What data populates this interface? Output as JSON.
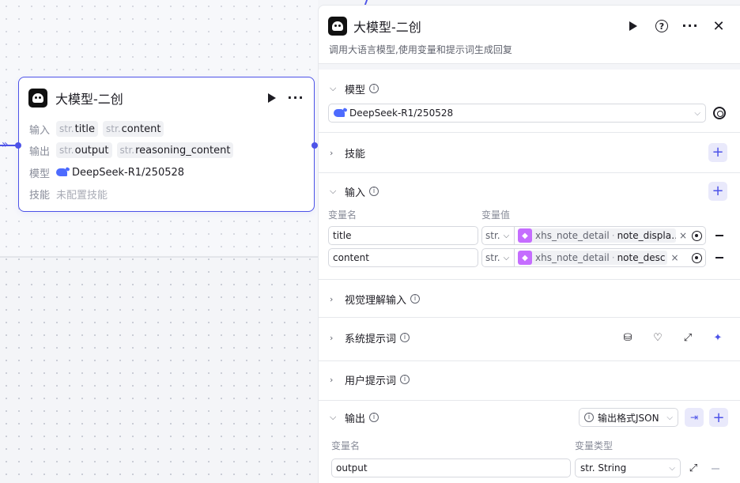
{
  "node": {
    "title": "大模型-二创",
    "input_label": "输入",
    "output_label": "输出",
    "model_label": "模型",
    "skill_label": "技能",
    "inputs": [
      {
        "type": "str.",
        "name": "title"
      },
      {
        "type": "str.",
        "name": "content"
      }
    ],
    "outputs": [
      {
        "type": "str.",
        "name": "output"
      },
      {
        "type": "str.",
        "name": "reasoning_content"
      }
    ],
    "model": "DeepSeek-R1/250528",
    "skill_value": "未配置技能"
  },
  "panel": {
    "title": "大模型-二创",
    "description": "调用大语言模型,使用变量和提示词生成回复",
    "sections": {
      "model": {
        "title": "模型",
        "selected": "DeepSeek-R1/250528"
      },
      "skills": {
        "title": "技能"
      },
      "input": {
        "title": "输入",
        "col_name": "变量名",
        "col_value": "变量值",
        "rows": [
          {
            "name": "title",
            "type": "str.",
            "ref_node": "xhs_note_detail",
            "ref_field": "note_displa…"
          },
          {
            "name": "content",
            "type": "str.",
            "ref_node": "xhs_note_detail",
            "ref_field": "note_desc"
          }
        ]
      },
      "vision": {
        "title": "视觉理解输入"
      },
      "system_prompt": {
        "title": "系统提示词"
      },
      "user_prompt": {
        "title": "用户提示词"
      },
      "output": {
        "title": "输出",
        "format_label": "输出格式JSON",
        "col_name": "变量名",
        "col_type": "变量类型",
        "rows": [
          {
            "name": "output",
            "type": "str. String"
          }
        ]
      }
    }
  },
  "colors": {
    "accent": "#4d53e8",
    "accent_soft": "#e9e9fb",
    "ref_icon": "#c56dff"
  }
}
